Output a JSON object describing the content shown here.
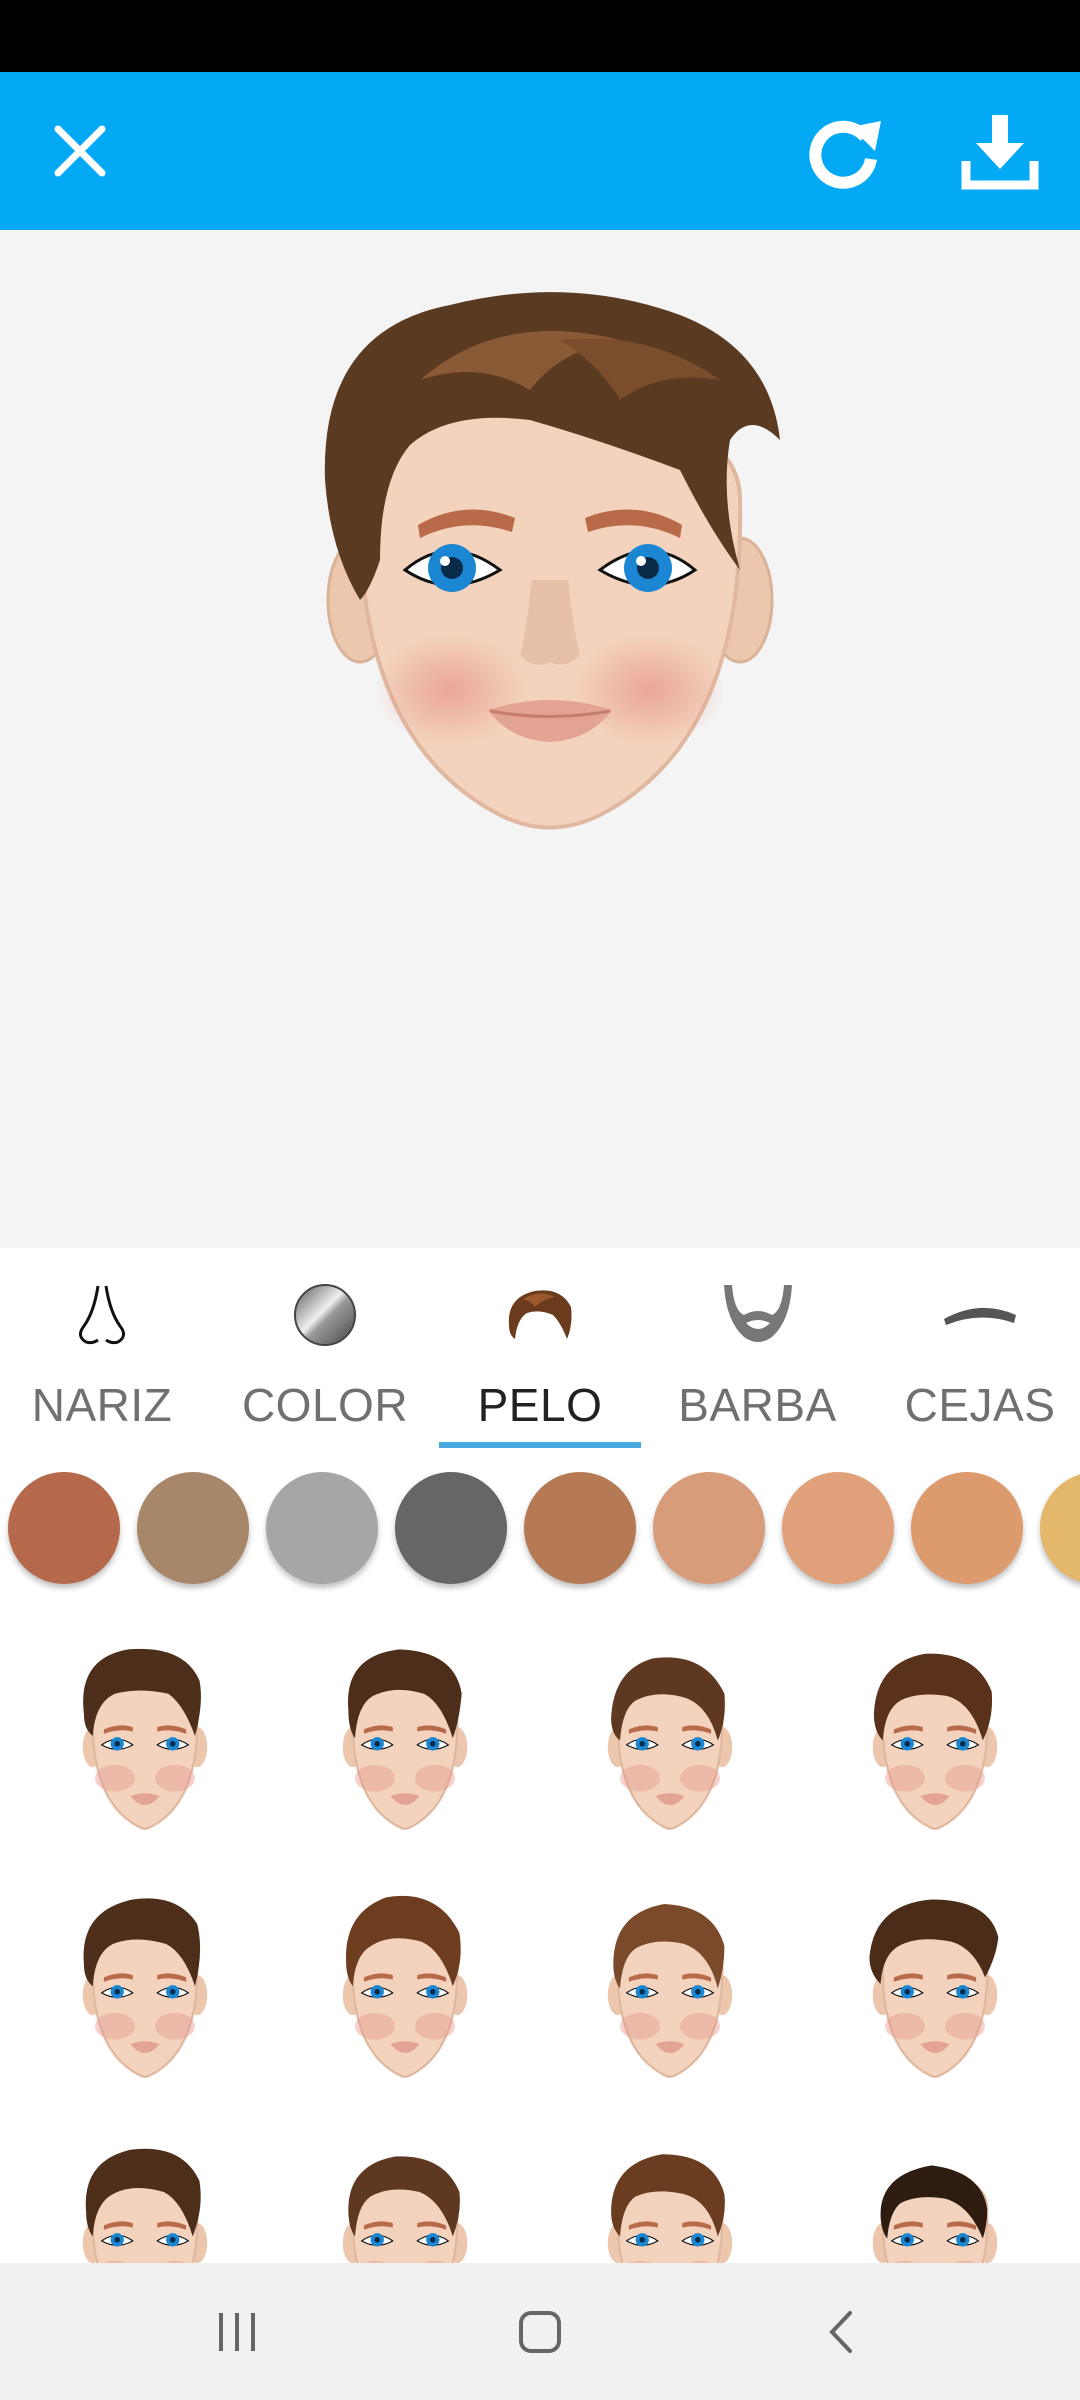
{
  "header": {
    "close_icon": "close-icon",
    "reset_icon": "refresh-icon",
    "download_icon": "download-icon",
    "bar_color": "#03a9f4"
  },
  "tabs": [
    {
      "label": "NARIZ",
      "icon": "nose-icon",
      "active": false
    },
    {
      "label": "COLOR",
      "icon": "color-icon",
      "active": false
    },
    {
      "label": "PELO",
      "icon": "hair-icon",
      "active": true
    },
    {
      "label": "BARBA",
      "icon": "beard-icon",
      "active": false
    },
    {
      "label": "CEJAS",
      "icon": "eyebrow-icon",
      "active": false
    }
  ],
  "hair_colors": [
    "#b5694a",
    "#a8866a",
    "#a6a6a6",
    "#666666",
    "#b57a54",
    "#d79d7a",
    "#e0a07a",
    "#dd9a6c",
    "#e3b86a"
  ],
  "hairstyle_options": [
    "hairstyle-1",
    "hairstyle-2",
    "hairstyle-3",
    "hairstyle-4",
    "hairstyle-5",
    "hairstyle-6",
    "hairstyle-7",
    "hairstyle-8",
    "hairstyle-9",
    "hairstyle-10",
    "hairstyle-11",
    "hairstyle-12"
  ],
  "navbar": {
    "recents_icon": "recents-icon",
    "home_icon": "home-icon",
    "back_icon": "back-icon"
  }
}
